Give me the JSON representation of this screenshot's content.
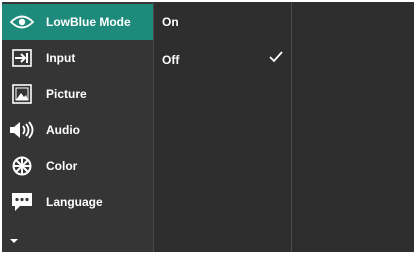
{
  "menu": {
    "items": [
      {
        "label": "LowBlue Mode",
        "icon": "eye-icon",
        "selected": true
      },
      {
        "label": "Input",
        "icon": "input-icon"
      },
      {
        "label": "Picture",
        "icon": "picture-icon"
      },
      {
        "label": "Audio",
        "icon": "speaker-icon"
      },
      {
        "label": "Color",
        "icon": "color-icon"
      },
      {
        "label": "Language",
        "icon": "language-icon"
      }
    ],
    "more_icon": "caret-down-icon"
  },
  "submenu": {
    "options": [
      {
        "label": "On",
        "checked": false
      },
      {
        "label": "Off",
        "checked": true
      }
    ],
    "check_icon": "checkmark-icon"
  },
  "colors": {
    "highlight": "#1e8a7b",
    "panel": "#353535",
    "text": "#ffffff"
  }
}
